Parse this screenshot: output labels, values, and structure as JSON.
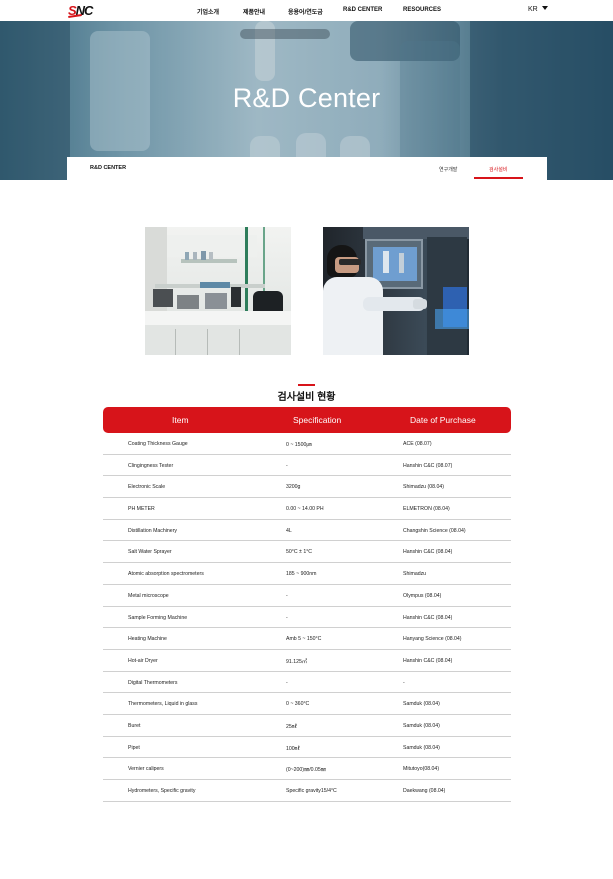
{
  "header": {
    "logo": {
      "s": "S",
      "rest": "NC"
    },
    "nav": [
      "기업소개",
      "제품안내",
      "응용어/연도금",
      "R&D CENTER",
      "RESOURCES"
    ],
    "lang": "KR"
  },
  "hero": {
    "title": "R&D Center"
  },
  "subnav": {
    "title": "R&D CENTER",
    "tabs": [
      {
        "label": "연구개발",
        "active": false
      },
      {
        "label": "검사설비",
        "active": true
      }
    ]
  },
  "section": {
    "title": "검사설비 현황"
  },
  "table": {
    "headers": [
      "Item",
      "Specification",
      "Date of Purchase"
    ],
    "rows": [
      [
        "Coating Thickness Gauge",
        "0 ~ 1500㎛",
        "ACE (08.07)"
      ],
      [
        "Clingingness Tester",
        "-",
        "Hanshin C&C (08.07)"
      ],
      [
        "Electronic Scale",
        "3200g",
        "Shimadzu (08.04)"
      ],
      [
        "PH METER",
        "0.00 ~ 14.00 PH",
        "ELMETRON (08.04)"
      ],
      [
        "Distillation Machinery",
        "4L",
        "Changshin Science (08.04)"
      ],
      [
        "Salt Water Sprayer",
        "50°C ± 1°C",
        "Hanshin C&C (08.04)"
      ],
      [
        "Atomic absorption spectrometers",
        "185 ~ 900nm",
        "Shimadzu"
      ],
      [
        "Metal microscope",
        "-",
        "Olympus (08.04)"
      ],
      [
        "Sample Forming Machine",
        "-",
        "Hanshin C&C (08.04)"
      ],
      [
        "Heating Machine",
        "Amb 5 ~ 150°C",
        "Hanyang Science (08.04)"
      ],
      [
        "Hot-air Dryer",
        "91.125㎥",
        "Hanshin C&C (08.04)"
      ],
      [
        "Digital Thermometers",
        "-",
        "-"
      ],
      [
        "Thermometers, Liquid in glass",
        "0 ~ 360°C",
        "Samduk (08.04)"
      ],
      [
        "Buret",
        "25㎖",
        "Samduk (08.04)"
      ],
      [
        "Pipet",
        "100㎖",
        "Samduk (08.04)"
      ],
      [
        "Vernier calipers",
        "(0~200)㎜/0.05㎜",
        "Mitutoyo(08.04)"
      ],
      [
        "Hydrometers, Specific gravity",
        "Specific gravity15/4°C",
        "Daekwang (08.04)"
      ]
    ]
  },
  "colors": {
    "accent": "#d7141a"
  }
}
